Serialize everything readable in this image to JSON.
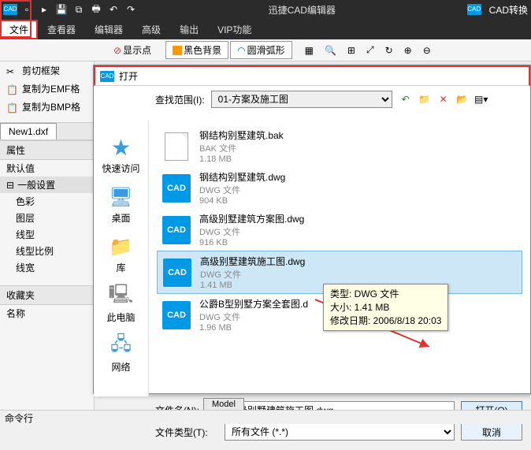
{
  "app": {
    "title": "迅捷CAD编辑器",
    "convert": "CAD转换"
  },
  "menu": {
    "file": "文件",
    "viewer": "查看器",
    "editor": "编辑器",
    "advanced": "高级",
    "output": "输出",
    "vip": "VIP功能"
  },
  "toolbar": {
    "crop": "剪切框架",
    "emf": "复制为EMF格",
    "bmp": "复制为BMP格",
    "show_points": "显示点",
    "black_bg": "黑色背景",
    "arc": "圆滑弧形"
  },
  "tabs": {
    "doc1": "New1.dxf"
  },
  "props": {
    "panel": "属性",
    "default": "默认值",
    "general": "一般设置",
    "color": "色彩",
    "layer": "图层",
    "linetype": "线型",
    "linescale": "线型比例",
    "lineweight": "线宽"
  },
  "fav": {
    "title": "收藏夹",
    "name": "名称"
  },
  "cmd": "命令行",
  "dialog": {
    "title": "打开",
    "lookup_label": "查找范围(I):",
    "lookup_value": "01-方案及施工图",
    "sidebar": {
      "quick": "快速访问",
      "desktop": "桌面",
      "library": "库",
      "thispc": "此电脑",
      "network": "网络"
    },
    "files": [
      {
        "name": "钢结构别墅建筑.bak",
        "type": "BAK 文件",
        "size": "1.18 MB",
        "kind": "blank"
      },
      {
        "name": "钢结构别墅建筑.dwg",
        "type": "DWG 文件",
        "size": "904 KB",
        "kind": "cad"
      },
      {
        "name": "高级别墅建筑方案图.dwg",
        "type": "DWG 文件",
        "size": "916 KB",
        "kind": "cad"
      },
      {
        "name": "高级别墅建筑施工图.dwg",
        "type": "DWG 文件",
        "size": "1.41 MB",
        "kind": "cad",
        "selected": true
      },
      {
        "name": "公爵B型别墅方案全套图.d",
        "type": "DWG 文件",
        "size": "1.96 MB",
        "kind": "cad"
      }
    ],
    "filename_label": "文件名(N):",
    "filename_value": "高级别墅建筑施工图.dwg",
    "filetype_label": "文件类型(T):",
    "filetype_value": "所有文件 (*.*)",
    "open_btn": "打开(O)",
    "cancel_btn": "取消"
  },
  "tooltip": {
    "l1": "类型: DWG 文件",
    "l2": "大小: 1.41 MB",
    "l3": "修改日期: 2006/8/18 20:03"
  },
  "model_tab": "Model"
}
